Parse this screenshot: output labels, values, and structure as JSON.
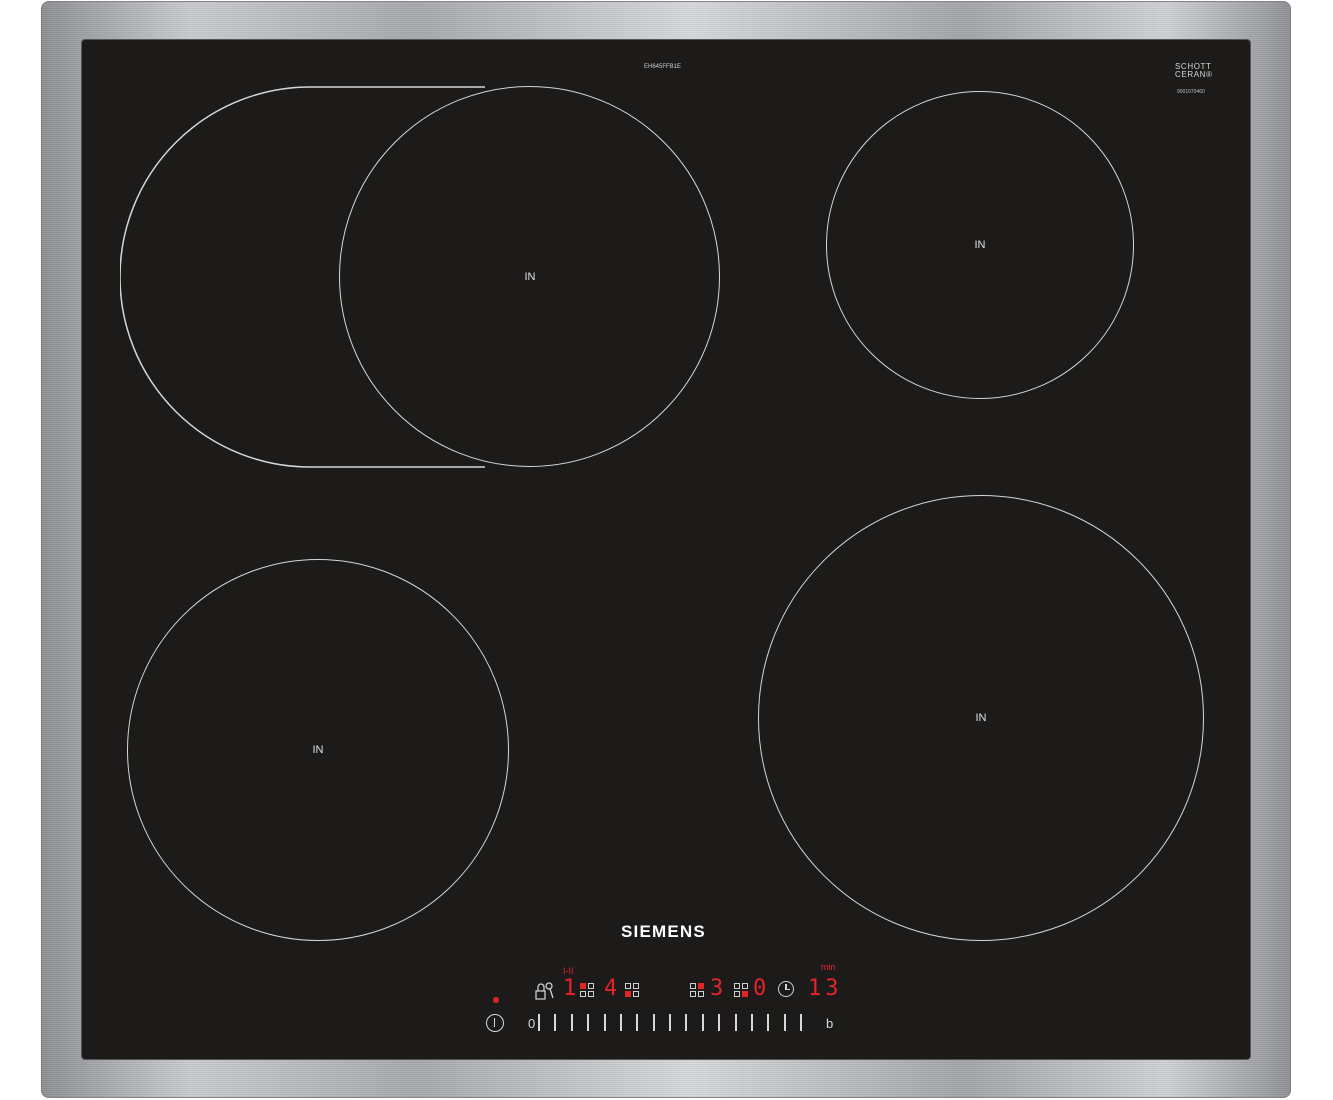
{
  "hob": {
    "model": "EH645FFB1E",
    "glass_brand": [
      "SCHOTT",
      "CERAN®"
    ],
    "serial": "9001070460",
    "brand": "SIEMENS"
  },
  "zones": [
    {
      "id": "rear-left-flex",
      "label": "IN"
    },
    {
      "id": "rear-right",
      "label": "IN"
    },
    {
      "id": "front-left",
      "label": "IN"
    },
    {
      "id": "front-right",
      "label": "IN"
    }
  ],
  "controls": {
    "zone_1_level": "1",
    "zone_1_sub": "I-II",
    "zone_2_level": "4",
    "zone_3_level": "3",
    "zone_4_level": "0",
    "timer_unit": "min",
    "timer_value": "13",
    "slider_min": "0",
    "boost": "b",
    "slider_ticks": 17
  },
  "colors": {
    "glass": "#1c1b1a",
    "display_red": "#e3242b",
    "markings": "#d6d6d6"
  }
}
